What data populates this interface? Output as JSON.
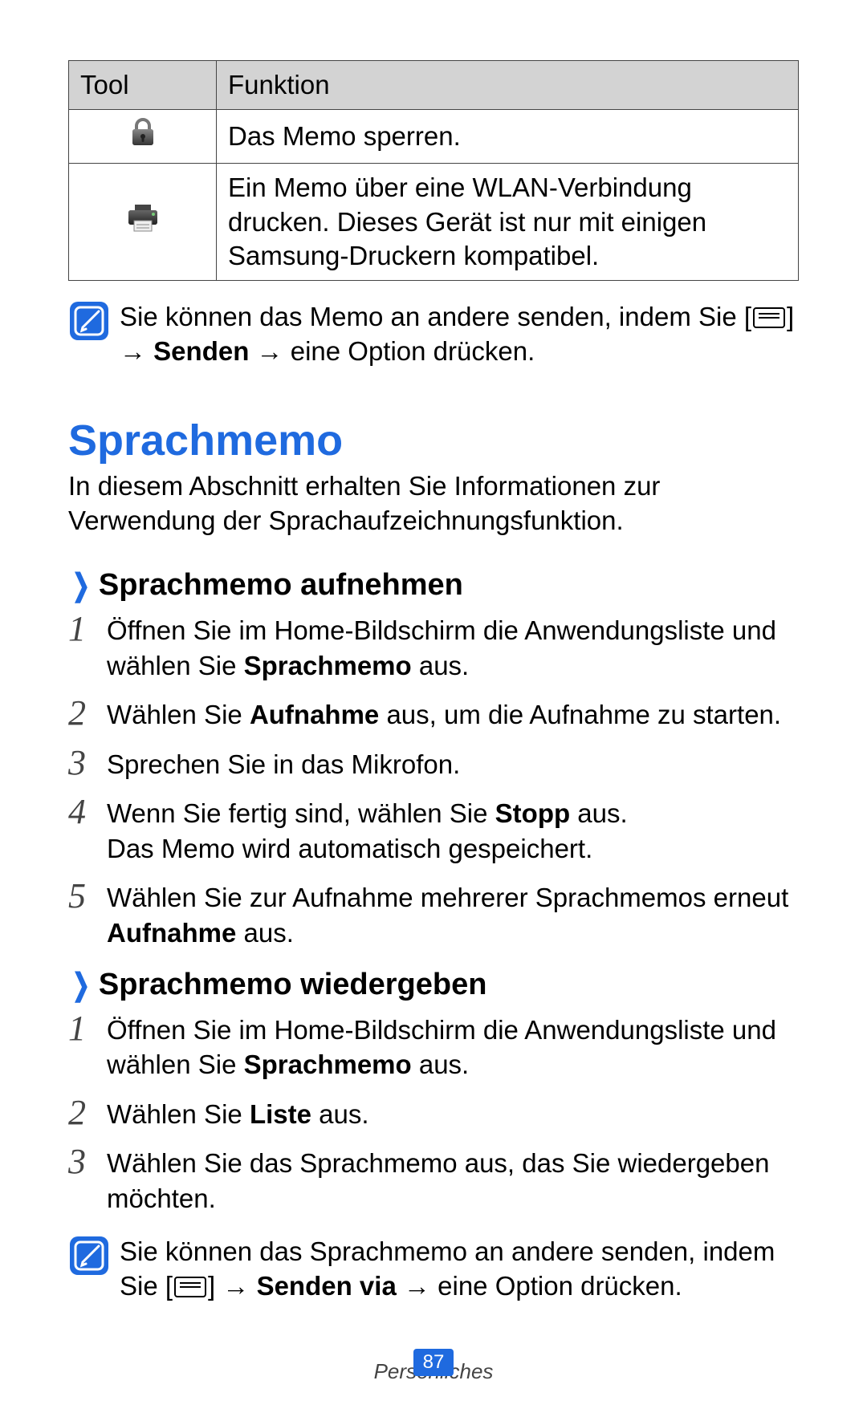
{
  "table": {
    "header": {
      "tool": "Tool",
      "func": "Funktion"
    },
    "rows": [
      {
        "icon": "lock-icon",
        "text": "Das Memo sperren."
      },
      {
        "icon": "printer-icon",
        "text": "Ein Memo über eine WLAN-Verbindung drucken. Dieses Gerät ist nur mit einigen Samsung-Druckern kompatibel."
      }
    ]
  },
  "note1": {
    "pre": "Sie können das Memo an andere senden, indem Sie [",
    "mid1": "] → ",
    "bold1": "Senden",
    "post": " → eine Option drücken."
  },
  "heading": "Sprachmemo",
  "intro": "In diesem Abschnitt erhalten Sie Informationen zur Verwendung der Sprachaufzeichnungsfunktion.",
  "section1": {
    "title": "Sprachmemo aufnehmen",
    "steps": [
      {
        "n": "1",
        "parts": [
          "Öffnen Sie im Home-Bildschirm die Anwendungsliste und wählen Sie ",
          "Sprachmemo",
          " aus."
        ]
      },
      {
        "n": "2",
        "parts": [
          "Wählen Sie ",
          "Aufnahme",
          " aus, um die Aufnahme zu starten."
        ]
      },
      {
        "n": "3",
        "parts": [
          "Sprechen Sie in das Mikrofon."
        ]
      },
      {
        "n": "4",
        "parts": [
          "Wenn Sie fertig sind, wählen Sie ",
          "Stopp",
          " aus."
        ],
        "extra": "Das Memo wird automatisch gespeichert."
      },
      {
        "n": "5",
        "parts": [
          "Wählen Sie zur Aufnahme mehrerer Sprachmemos erneut ",
          "Aufnahme",
          " aus."
        ]
      }
    ]
  },
  "section2": {
    "title": "Sprachmemo wiedergeben",
    "steps": [
      {
        "n": "1",
        "parts": [
          "Öffnen Sie im Home-Bildschirm die Anwendungsliste und wählen Sie ",
          "Sprachmemo",
          " aus."
        ]
      },
      {
        "n": "2",
        "parts": [
          "Wählen Sie ",
          "Liste",
          " aus."
        ]
      },
      {
        "n": "3",
        "parts": [
          "Wählen Sie das Sprachmemo aus, das Sie wiedergeben möchten."
        ]
      }
    ]
  },
  "note2": {
    "pre": "Sie können das Sprachmemo an andere senden, indem Sie [",
    "mid1": "] → ",
    "bold1": "Senden via",
    "post": " → eine Option drücken."
  },
  "footer": {
    "section": "Persönliches",
    "page": "87"
  }
}
